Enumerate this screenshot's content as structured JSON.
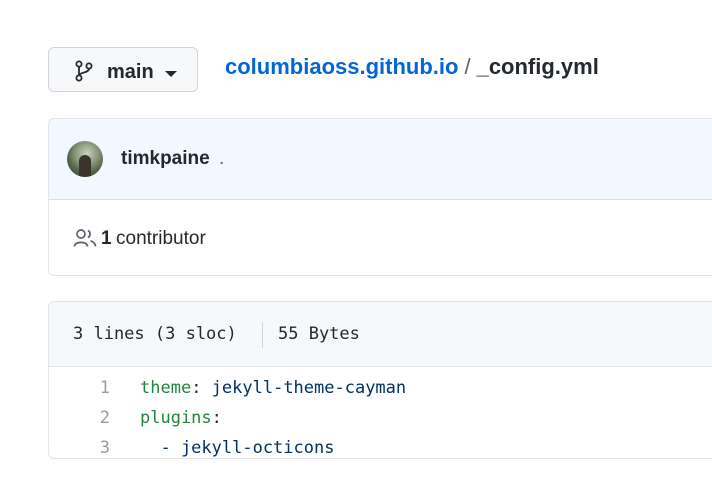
{
  "branch": {
    "label": "main",
    "icon": "git-branch-icon"
  },
  "breadcrumb": {
    "repo": "columbiaoss.github.io",
    "separator": "/",
    "file": "_config.yml"
  },
  "commit": {
    "author": "timkpaine",
    "message": "."
  },
  "contributors": {
    "count": "1",
    "label": "contributor",
    "icon": "people-icon"
  },
  "file_info": {
    "lines": "3 lines (3 sloc)",
    "size": "55 Bytes"
  },
  "code": {
    "lines": [
      {
        "num": "1",
        "key": "theme",
        "punct": ":",
        "value": " jekyll-theme-cayman"
      },
      {
        "num": "2",
        "key": "plugins",
        "punct": ":",
        "value": ""
      },
      {
        "num": "3",
        "key": "",
        "punct": "",
        "value": "  - jekyll-octicons"
      }
    ]
  },
  "colors": {
    "link": "#0366d6",
    "yaml_key": "#22863a",
    "yaml_value": "#032f62",
    "header_bg": "#f1f8ff"
  }
}
